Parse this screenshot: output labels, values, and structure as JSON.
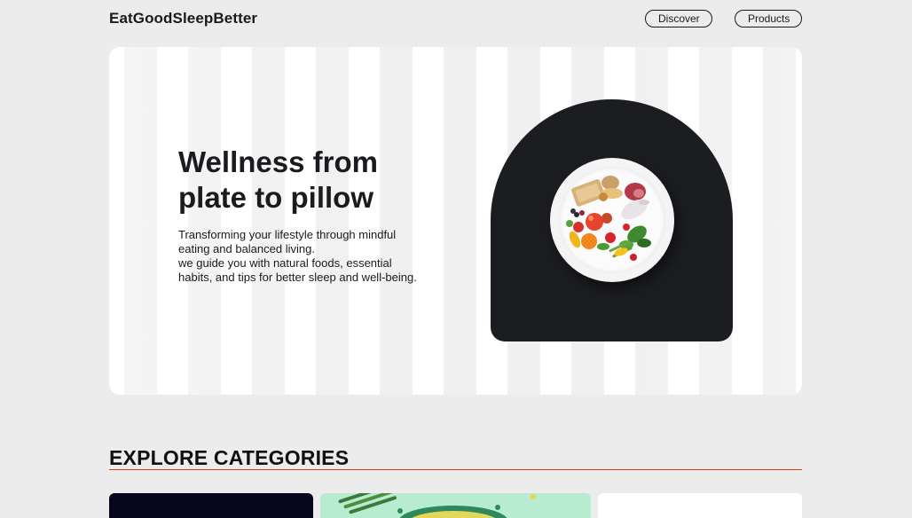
{
  "header": {
    "brand": "EatGoodSleepBetter",
    "nav": [
      {
        "label": "Discover"
      },
      {
        "label": "Products"
      }
    ]
  },
  "hero": {
    "title": "Wellness from plate to pillow",
    "body_line1": "Transforming your lifestyle through mindful eating and balanced living.",
    "body_line2": "we guide you with natural foods, essential habits, and tips for better sleep and well-being.",
    "image": "healthy-food-plate"
  },
  "categories": {
    "title": "EXPLORE CATEGORIES",
    "accent_color": "#d9401f",
    "cards": [
      {
        "name": "category-card-dark"
      },
      {
        "name": "category-card-vegetables"
      },
      {
        "name": "category-card-light"
      }
    ]
  },
  "colors": {
    "background": "#ececec",
    "arch": "#1c1d21",
    "text": "#1a1a1a"
  }
}
